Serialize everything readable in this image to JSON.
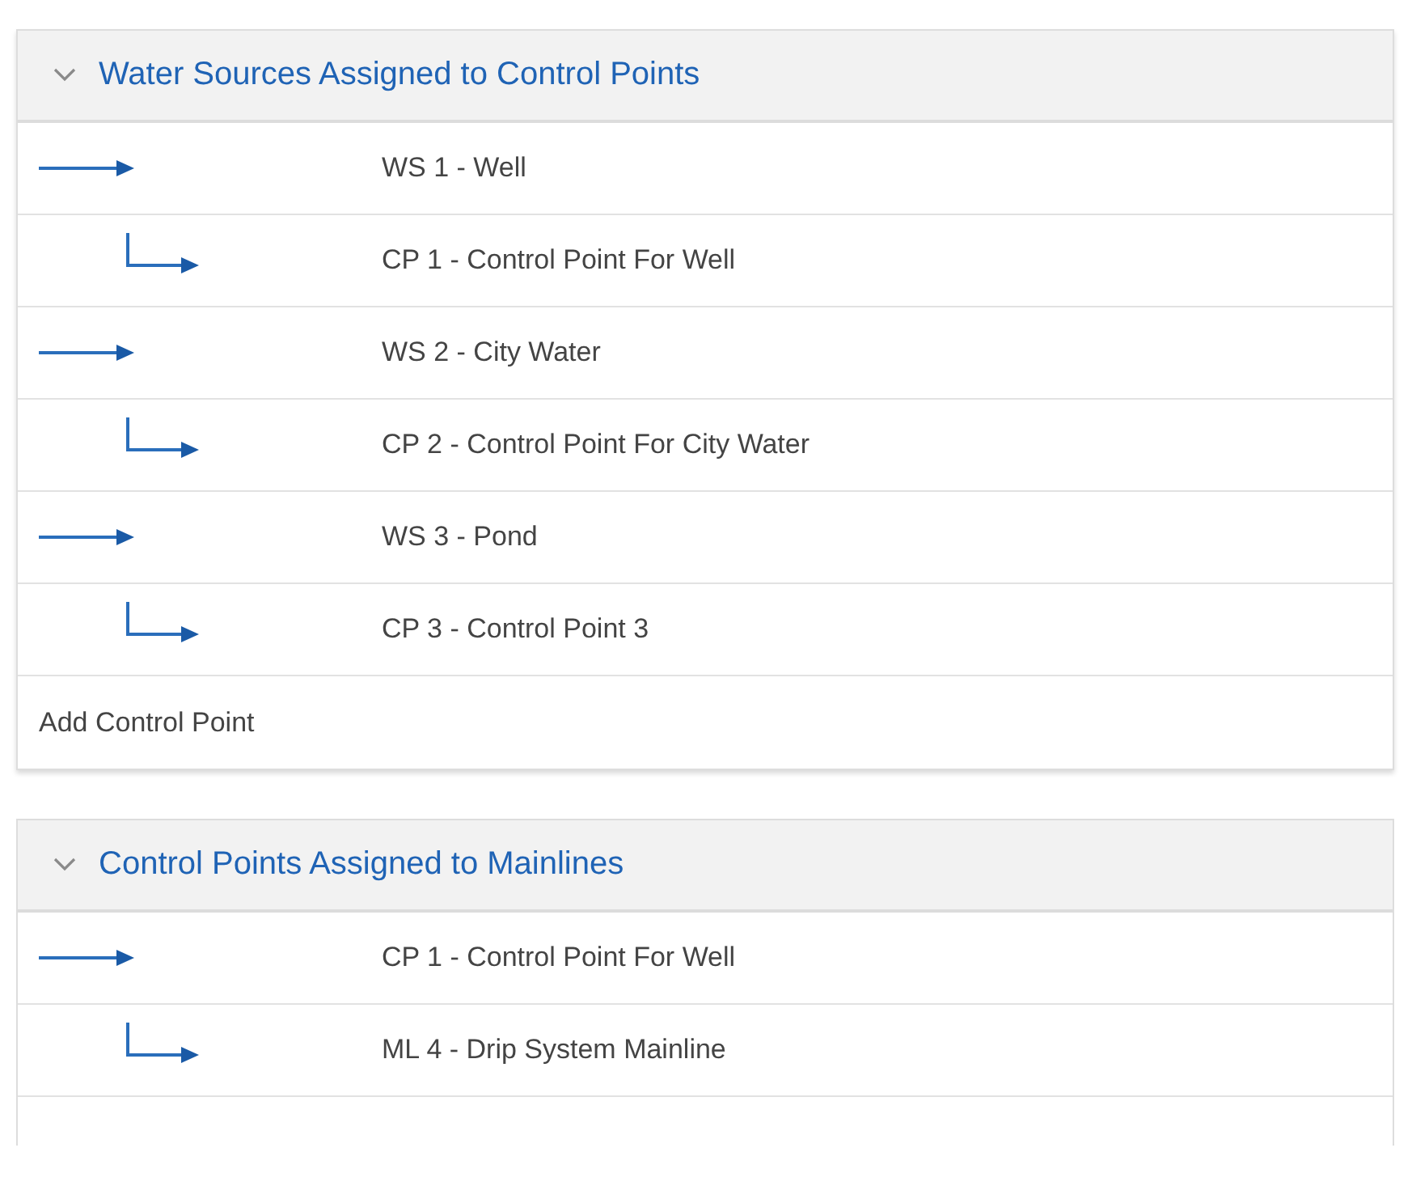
{
  "sections": [
    {
      "title": "Water Sources Assigned to Control Points",
      "expanded": true,
      "rows": [
        {
          "kind": "parent",
          "label": "WS 1 - Well"
        },
        {
          "kind": "child",
          "label": "CP 1 - Control Point For Well"
        },
        {
          "kind": "parent",
          "label": "WS 2 - City Water"
        },
        {
          "kind": "child",
          "label": "CP 2 - Control Point For City Water"
        },
        {
          "kind": "parent",
          "label": "WS 3 - Pond"
        },
        {
          "kind": "child",
          "label": "CP 3 - Control Point 3"
        }
      ],
      "action": "Add Control Point"
    },
    {
      "title": "Control Points Assigned to Mainlines",
      "expanded": true,
      "rows": [
        {
          "kind": "parent",
          "label": "CP 1 - Control Point For Well"
        },
        {
          "kind": "child",
          "label": "ML 4 - Drip System Mainline"
        }
      ]
    }
  ]
}
